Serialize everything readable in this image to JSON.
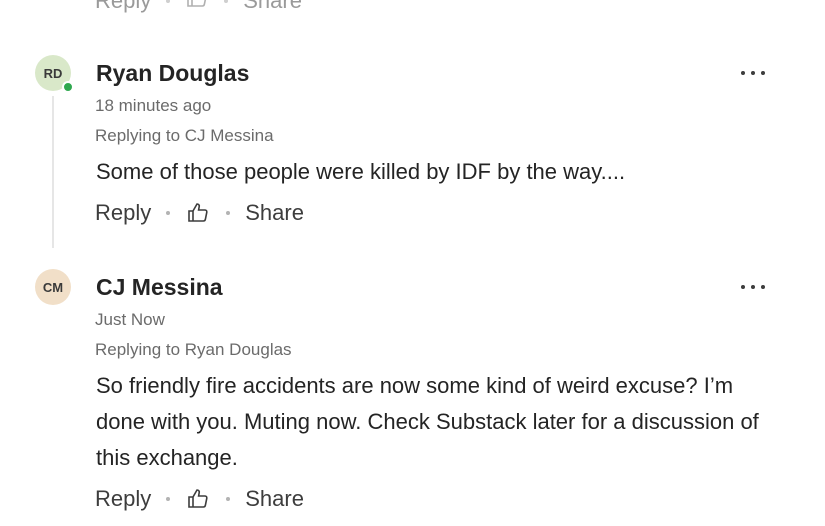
{
  "partial_actions": {
    "reply": "Reply",
    "share": "Share"
  },
  "comments": [
    {
      "initials": "RD",
      "avatar_color": "#d9e8c9",
      "online": true,
      "author": "Ryan Douglas",
      "time": "18 minutes ago",
      "replying_to": "Replying to CJ Messina",
      "body": "Some of those people were killed by IDF by the way....",
      "reply": "Reply",
      "share": "Share"
    },
    {
      "initials": "CM",
      "avatar_color": "#f1dfc8",
      "online": false,
      "author": "CJ Messina",
      "time": "Just Now",
      "replying_to": "Replying to Ryan Douglas",
      "body": "So friendly fire accidents are now some kind of weird excuse?  I’m done with you.  Muting now.  Check Substack later for a discussion of this exchange.",
      "reply": "Reply",
      "share": "Share"
    }
  ]
}
